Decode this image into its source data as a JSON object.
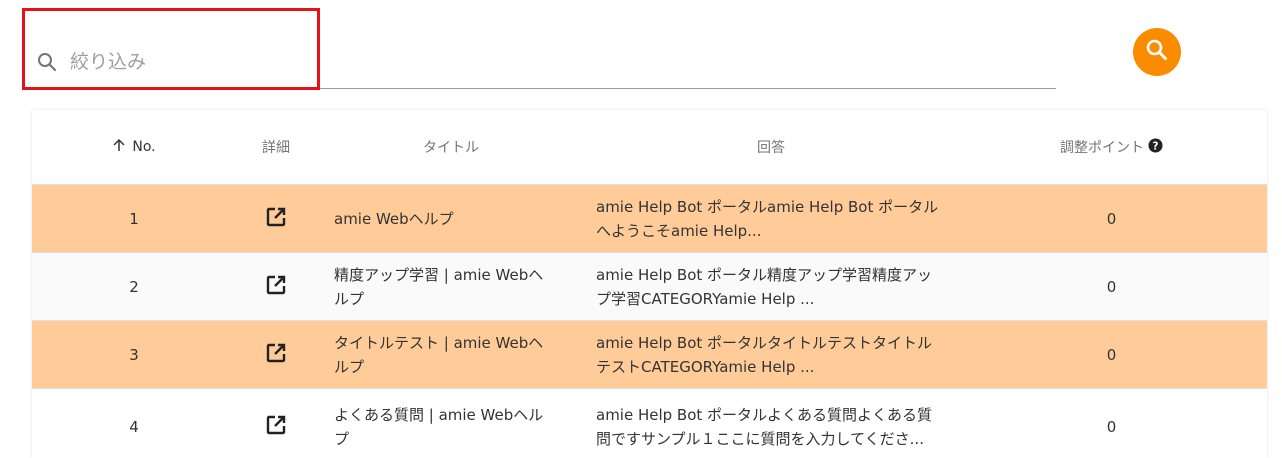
{
  "search": {
    "placeholder": "絞り込み",
    "icon": "search-icon",
    "button_icon": "search-icon",
    "button_color": "#fb8c00",
    "highlight_color": "#e8111a"
  },
  "table": {
    "headers": {
      "no": "No.",
      "no_sort_icon": "arrow-up-icon",
      "detail": "詳細",
      "title": "タイトル",
      "answer": "回答",
      "points": "調整ポイント",
      "points_help_icon": "question-circle-icon"
    },
    "rows": [
      {
        "no": "1",
        "detail_icon": "open-in-new-icon",
        "title": "amie Webヘルプ",
        "answer": "amie Help Bot ポータルamie Help Bot ポータルへようこそamie Help...",
        "points": "0",
        "highlight": "#ffcc99"
      },
      {
        "no": "2",
        "detail_icon": "open-in-new-icon",
        "title": "精度アップ学習 | amie Webヘルプ",
        "answer": "amie Help Bot ポータル精度アップ学習精度アップ学習CATEGORYamie Help ...",
        "points": "0",
        "highlight": "#fafafa"
      },
      {
        "no": "3",
        "detail_icon": "open-in-new-icon",
        "title": "タイトルテスト | amie Webヘルプ",
        "answer": "amie Help Bot ポータルタイトルテストタイトルテストCATEGORYamie Help ...",
        "points": "0",
        "highlight": "#ffcc99"
      },
      {
        "no": "4",
        "detail_icon": "open-in-new-icon",
        "title": "よくある質問 | amie Webヘルプ",
        "answer": "amie Help Bot ポータルよくある質問よくある質問ですサンプル１ここに質問を入力してくださ...",
        "points": "0",
        "highlight": "#ffffff"
      }
    ]
  }
}
